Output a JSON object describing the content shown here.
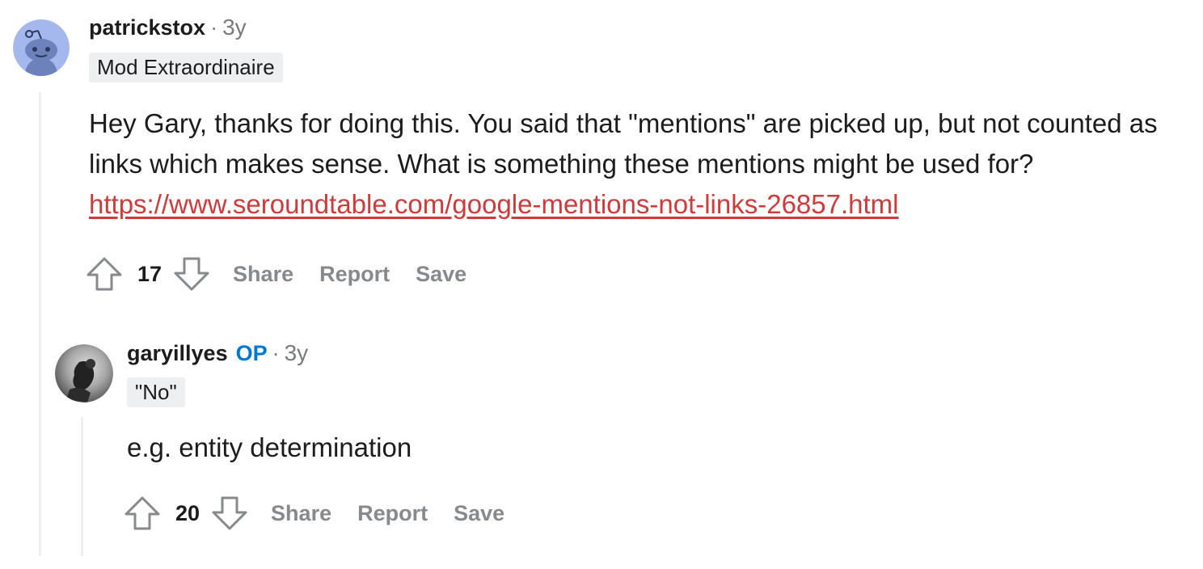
{
  "comments": [
    {
      "username": "patrickstox",
      "separator": "·",
      "age": "3y",
      "flair": "Mod Extraordinaire",
      "body_text": "Hey Gary, thanks for doing this. You said that \"mentions\" are picked up, but not counted as links which makes sense. What is something these mentions might be used for? ",
      "link_text": "https://www.seroundtable.com/google-mentions-not-links-26857.html",
      "score": "17",
      "actions": {
        "share": "Share",
        "report": "Report",
        "save": "Save"
      }
    },
    {
      "username": "garyillyes",
      "op_badge": "OP",
      "separator": "·",
      "age": "3y",
      "flair": "\"No\"",
      "body_text": "e.g. entity determination",
      "score": "20",
      "actions": {
        "share": "Share",
        "report": "Report",
        "save": "Save"
      }
    }
  ],
  "colors": {
    "link": "#d13a3a",
    "op": "#0079d3",
    "muted": "#878a8c",
    "avatar_bg": "#a5b8ee"
  },
  "icons": [
    "reddit-snoo-avatar-icon",
    "upvote-arrow-icon",
    "downvote-arrow-icon"
  ]
}
